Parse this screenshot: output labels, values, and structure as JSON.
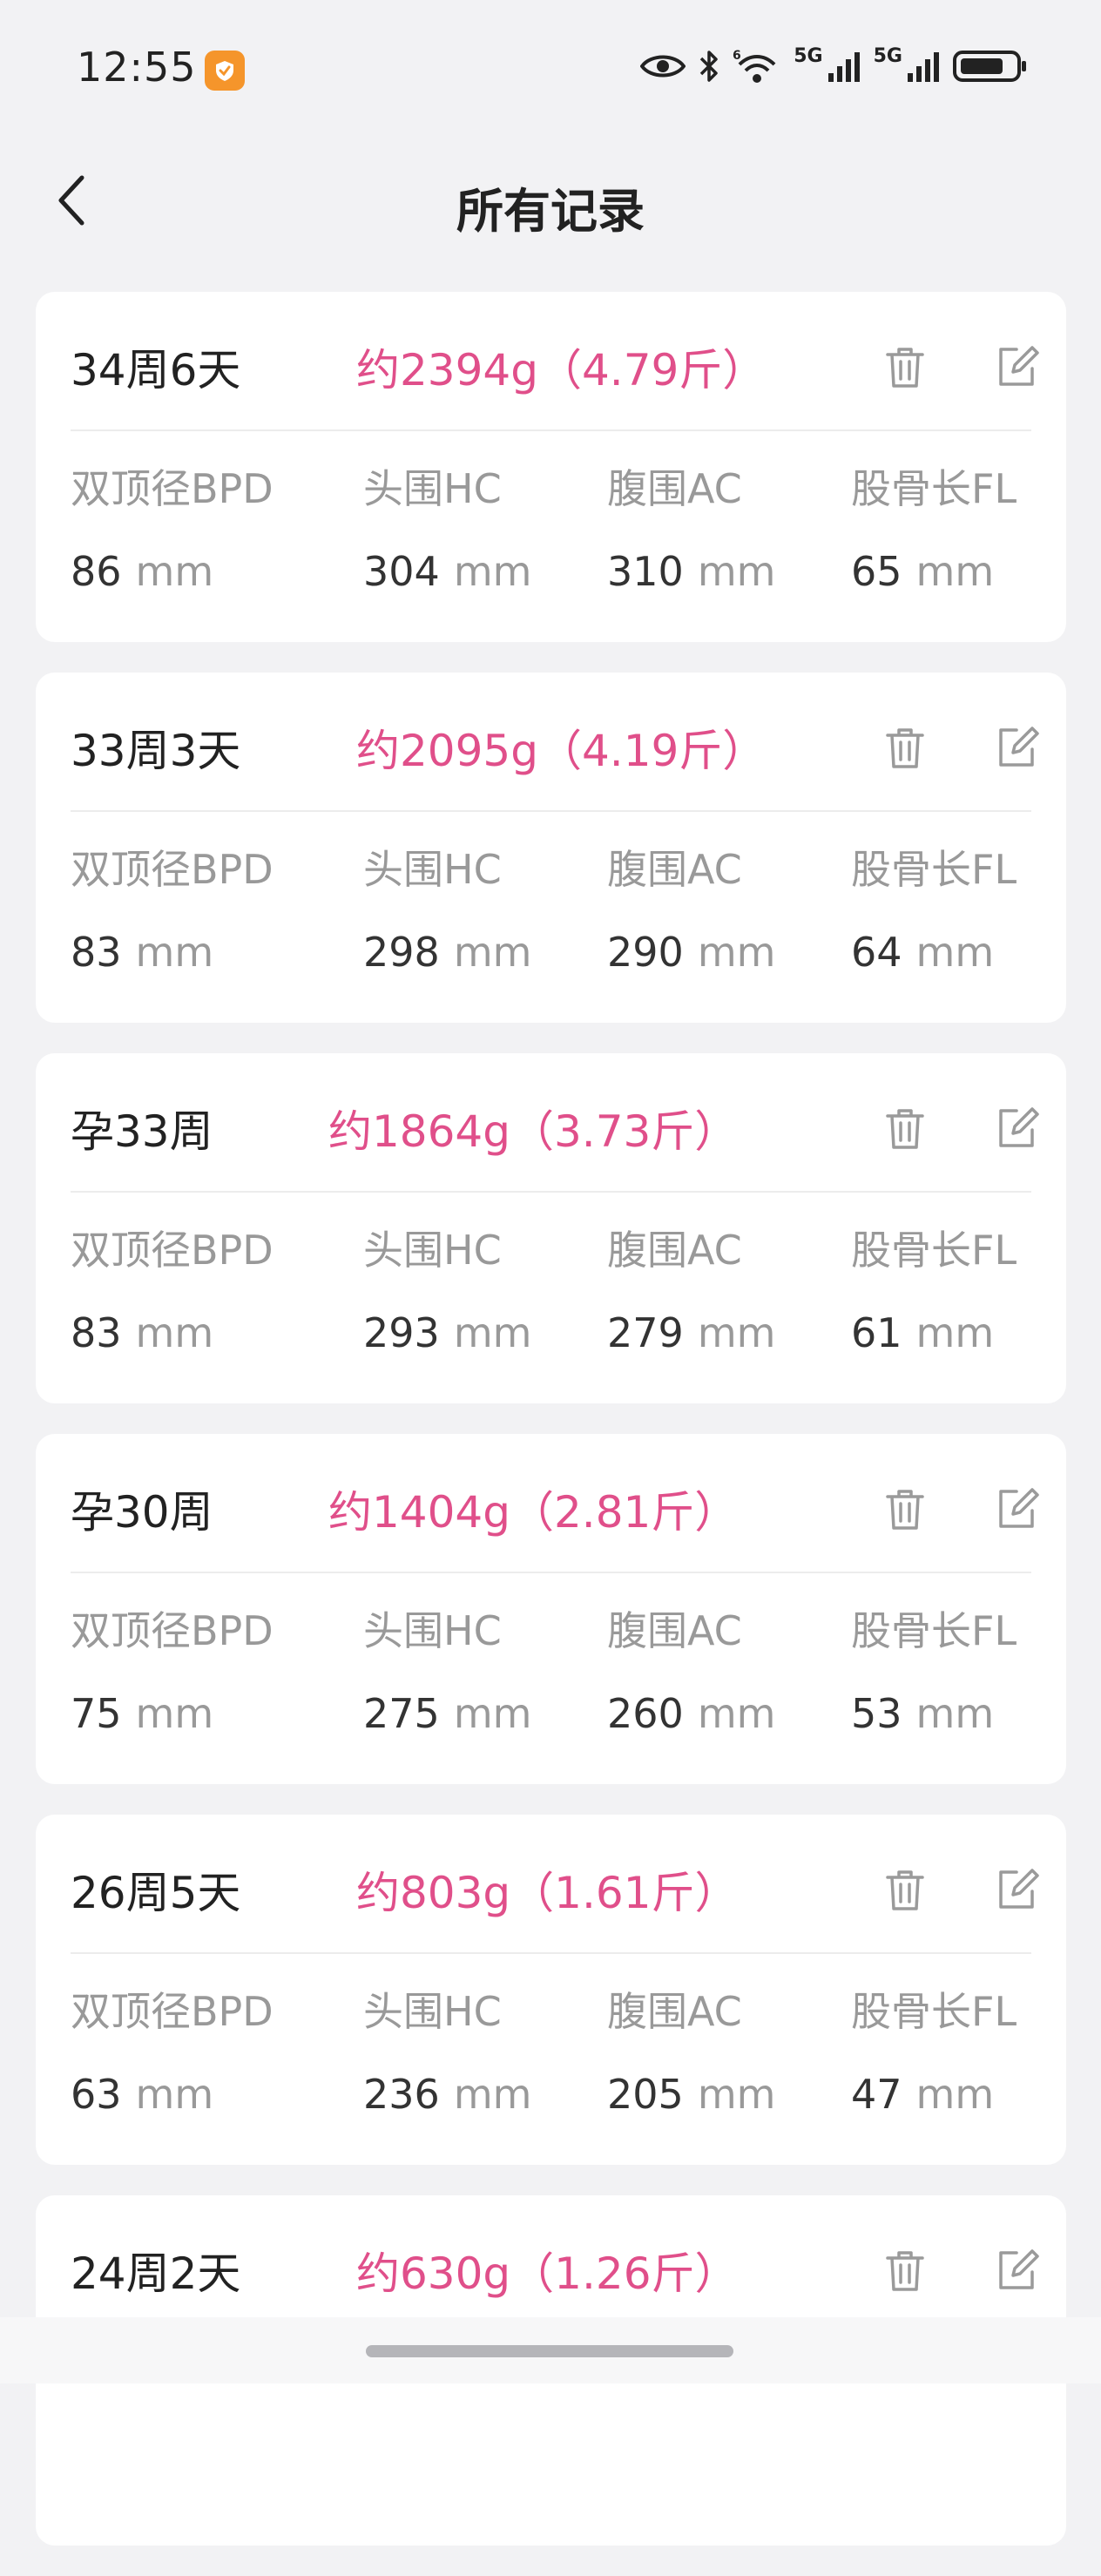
{
  "status": {
    "time": "12:55",
    "net1": "5G",
    "net2": "5G",
    "wifi_badge": "6"
  },
  "header": {
    "title": "所有记录"
  },
  "metric_labels": {
    "bpd": "双顶径BPD",
    "hc": "头围HC",
    "ac": "腹围AC",
    "fl": "股骨长FL"
  },
  "unit": "mm",
  "records": [
    {
      "week": "34周6天",
      "weight": "约2394g（4.79斤）",
      "bpd": "86",
      "hc": "304",
      "ac": "310",
      "fl": "65"
    },
    {
      "week": "33周3天",
      "weight": "约2095g（4.19斤）",
      "bpd": "83",
      "hc": "298",
      "ac": "290",
      "fl": "64"
    },
    {
      "week": "孕33周",
      "weight": "约1864g（3.73斤）",
      "bpd": "83",
      "hc": "293",
      "ac": "279",
      "fl": "61"
    },
    {
      "week": "孕30周",
      "weight": "约1404g（2.81斤）",
      "bpd": "75",
      "hc": "275",
      "ac": "260",
      "fl": "53"
    },
    {
      "week": "26周5天",
      "weight": "约803g（1.61斤）",
      "bpd": "63",
      "hc": "236",
      "ac": "205",
      "fl": "47"
    },
    {
      "week": "24周2天",
      "weight": "约630g（1.26斤）"
    }
  ],
  "colors": {
    "accent": "#e04f8a",
    "background": "#f2f2f4",
    "card": "#ffffff"
  }
}
